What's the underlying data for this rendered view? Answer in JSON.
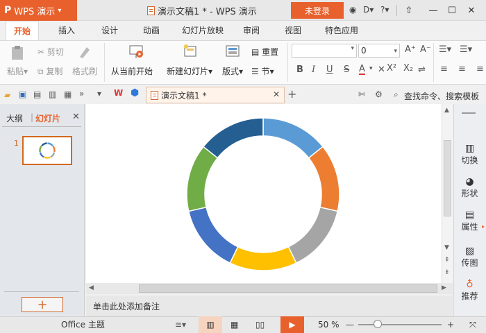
{
  "app": {
    "name": "WPS 演示",
    "logo": "P"
  },
  "window": {
    "title": "演示文稿1 * - WPS 演示",
    "login_label": "未登录",
    "help": "?"
  },
  "menu": {
    "tabs": [
      "开始",
      "插入",
      "设计",
      "动画",
      "幻灯片放映",
      "审阅",
      "视图",
      "特色应用"
    ],
    "active": 0
  },
  "ribbon": {
    "paste": "粘贴",
    "cut": "剪切",
    "copy": "复制",
    "format_painter": "格式刷",
    "from_current": "从当前开始",
    "new_slide": "新建幻灯片",
    "layout": "版式",
    "reset": "重置",
    "section": "节",
    "font_size": "0",
    "bold": "B",
    "italic": "I",
    "underline": "U",
    "strike": "S",
    "fontcolor": "A",
    "superscript": "X²",
    "subscript": "X₂"
  },
  "quickbar": {
    "doc_tab": "演示文稿1 *",
    "search": "查找命令、搜索模板"
  },
  "leftpanel": {
    "outline_tab": "大纲",
    "slides_tab": "幻灯片",
    "slide_number": "1",
    "add": "+"
  },
  "notes": {
    "placeholder": "单击此处添加备注"
  },
  "rightpanel": {
    "items": [
      "切换",
      "形状",
      "属性",
      "传图",
      "推荐"
    ]
  },
  "statusbar": {
    "theme": "Office 主题",
    "zoom": "50 %"
  },
  "colors": {
    "accent": "#e8612c",
    "selected_border": "#d2691e"
  },
  "chart_data": {
    "type": "pie",
    "style": "donut",
    "values": [
      1,
      1,
      1,
      1,
      1,
      1,
      1
    ],
    "colors": [
      "#5b9bd5",
      "#ed7d31",
      "#a5a5a5",
      "#ffc000",
      "#4472c4",
      "#70ad47",
      "#255e91"
    ]
  }
}
